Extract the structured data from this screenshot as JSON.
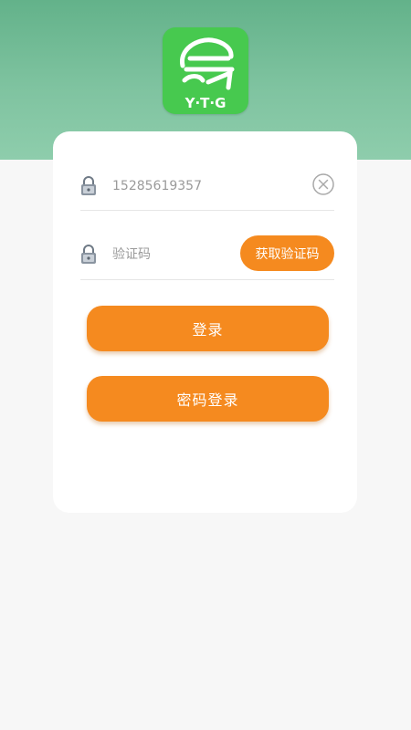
{
  "header": {
    "logo_text": "Y·T·G",
    "colors": {
      "header_bg": "#63b28a",
      "logo_bg": "#47c94f",
      "accent": "#f58a1f"
    }
  },
  "form": {
    "phone": {
      "value": "15285619357",
      "icon": "lock-icon",
      "clear_icon": "close-circle-icon"
    },
    "code": {
      "placeholder": "验证码",
      "icon": "lock-icon",
      "get_code_label": "获取验证码"
    },
    "login_label": "登录",
    "password_login_label": "密码登录"
  }
}
